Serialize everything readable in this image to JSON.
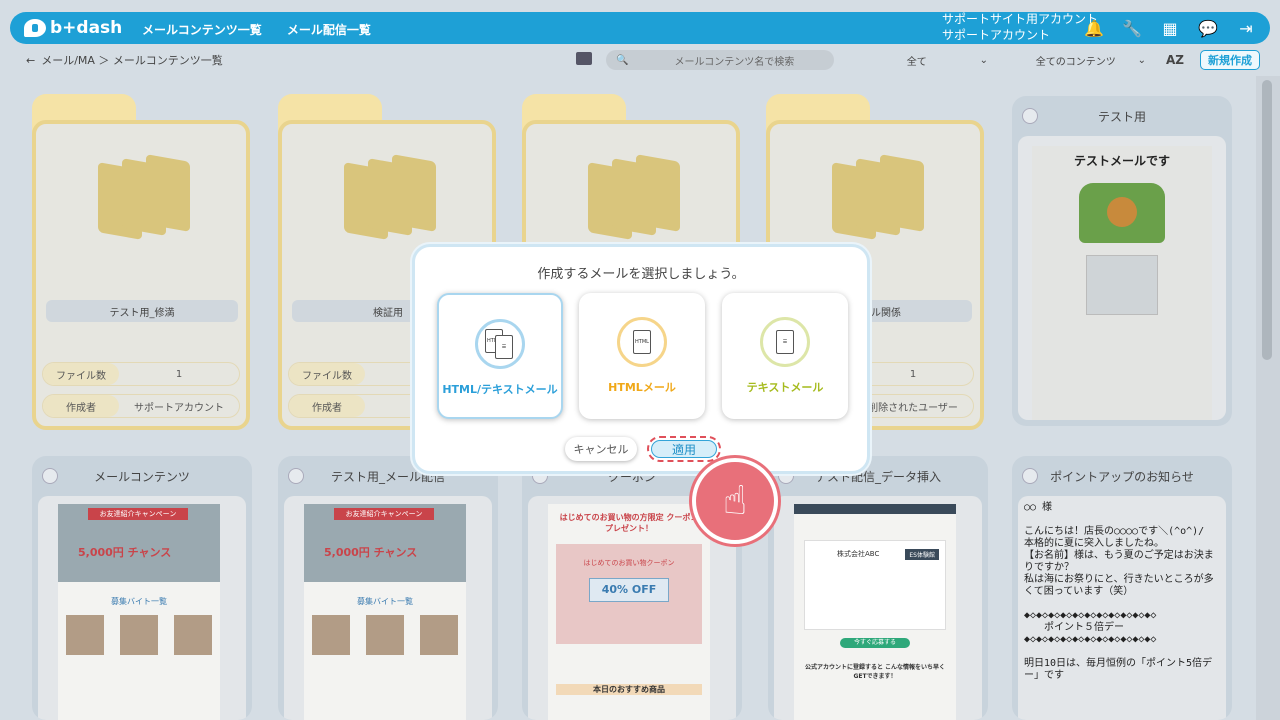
{
  "app": {
    "brand": "b+dash",
    "nav": [
      "メールコンテンツ一覧",
      "メール配信一覧"
    ],
    "account_line1": "サポートサイト用アカウント",
    "account_line2": "サポートアカウント"
  },
  "subbar": {
    "back": "←",
    "crumb": "メール/MA ＞ メールコンテンツ一覧",
    "search_placeholder": "メールコンテンツ名で検索",
    "filter1": "全て",
    "filter2": "全てのコンテンツ",
    "sort": "AZ",
    "new_button": "新規作成"
  },
  "folders": [
    {
      "name": "テスト用_修満",
      "file_label": "ファイル数",
      "file_count": "1",
      "owner_label": "作成者",
      "owner": "サポートアカウント"
    },
    {
      "name": "検証用",
      "file_label": "ファイル数",
      "file_count": "",
      "owner_label": "作成者",
      "owner": "サポ"
    },
    {
      "name": "",
      "file_label": "",
      "file_count": "",
      "owner_label": "",
      "owner": ""
    },
    {
      "name": "メール関係",
      "file_label": "",
      "file_count": "1",
      "owner_label": "",
      "owner": "削除されたユーザー"
    }
  ],
  "test_card": {
    "title": "テスト用",
    "body": "テストメールです"
  },
  "mail_cards": [
    {
      "title": "メールコンテンツ",
      "ribbon": "お友達紹介キャンペーン",
      "big": "5,000円 チャンス",
      "section": "募集バイト一覧"
    },
    {
      "title": "テスト用_メール配信",
      "ribbon": "お友達紹介キャンペーン",
      "big": "5,000円 チャンス",
      "section": "募集バイト一覧"
    }
  ],
  "coupon_card": {
    "title": "クーポン",
    "head": "はじめてのお買い物の方限定 クーポンプレゼント！",
    "sub": "はじめてのお買い物クーポン",
    "off": "40% OFF",
    "footer": "本日のおすすめ商品"
  },
  "delivery_card": {
    "title": "テスト配信_データ挿入",
    "company": "株式会社ABC",
    "badge": "ES体験館",
    "cta": "今すぐ応募する",
    "follow": "公式アカウントに登録すると こんな情報をいち早くGETできます！"
  },
  "point_card": {
    "title": "ポイントアップのお知らせ",
    "body": "○○ 様\n\nこんにちは！店長の○○○○です＼(^o^)/\n本格的に夏に突入しましたね。\n【お名前】様は、もう夏のご予定はお決まりですか？\n私は海にお祭りにと、行きたいところが多くて困っています（笑）\n\n◆◇◆◇◆◇◆◇◆◇◆◇◆◇◆◇◆◇◆◇◆◇\n　　ポイント５倍デー\n◆◇◆◇◆◇◆◇◆◇◆◇◆◇◆◇◆◇◆◇◆◇\n\n明日10日は、毎月恒例の「ポイント5倍デー」です"
  },
  "modal": {
    "title": "作成するメールを選択しましょう。",
    "options": [
      {
        "label": "HTML/テキストメール",
        "color": "#2b9fd9"
      },
      {
        "label": "HTMLメール",
        "color": "#f0a818"
      },
      {
        "label": "テキストメール",
        "color": "#a6bb1e"
      }
    ],
    "cancel": "キャンセル",
    "apply": "適用"
  }
}
